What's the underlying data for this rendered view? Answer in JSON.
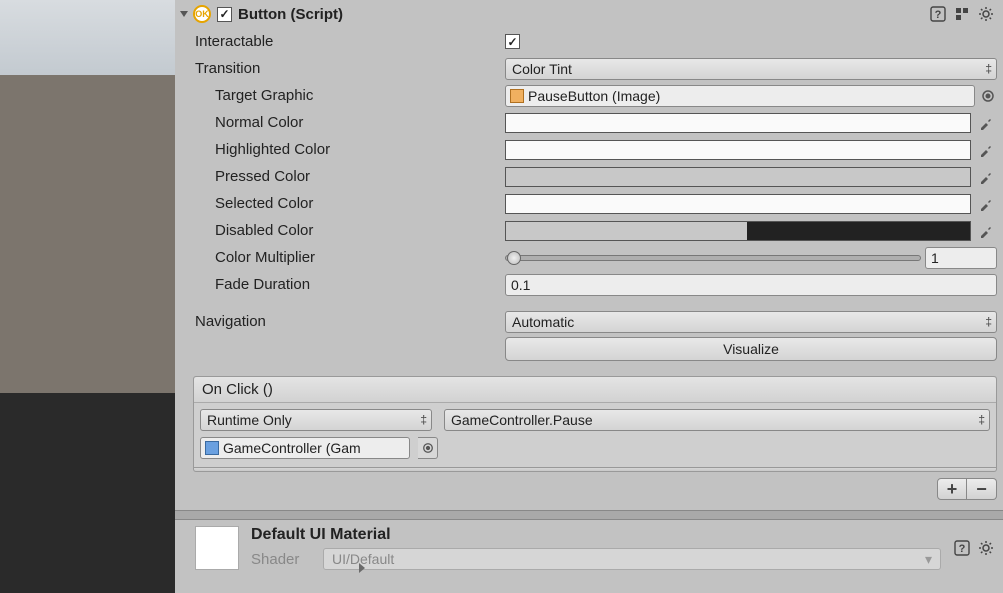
{
  "component": {
    "title": "Button (Script)",
    "enabled": true,
    "interactable_label": "Interactable",
    "interactable": true,
    "transition_label": "Transition",
    "transition_value": "Color Tint",
    "target_graphic_label": "Target Graphic",
    "target_graphic_value": "PauseButton (Image)",
    "normal_color_label": "Normal Color",
    "highlighted_color_label": "Highlighted Color",
    "pressed_color_label": "Pressed Color",
    "selected_color_label": "Selected Color",
    "disabled_color_label": "Disabled Color",
    "color_multiplier_label": "Color Multiplier",
    "color_multiplier_value": "1",
    "fade_duration_label": "Fade Duration",
    "fade_duration_value": "0.1",
    "navigation_label": "Navigation",
    "navigation_value": "Automatic",
    "visualize_label": "Visualize"
  },
  "onclick": {
    "title": "On Click ()",
    "runtime_value": "Runtime Only",
    "function_value": "GameController.Pause",
    "target_object": "GameController (Gam"
  },
  "material": {
    "name": "Default UI Material",
    "shader_label": "Shader",
    "shader_value": "UI/Default"
  },
  "icons": {
    "help": "help-icon",
    "preset": "preset-icon",
    "settings": "gear-icon"
  }
}
